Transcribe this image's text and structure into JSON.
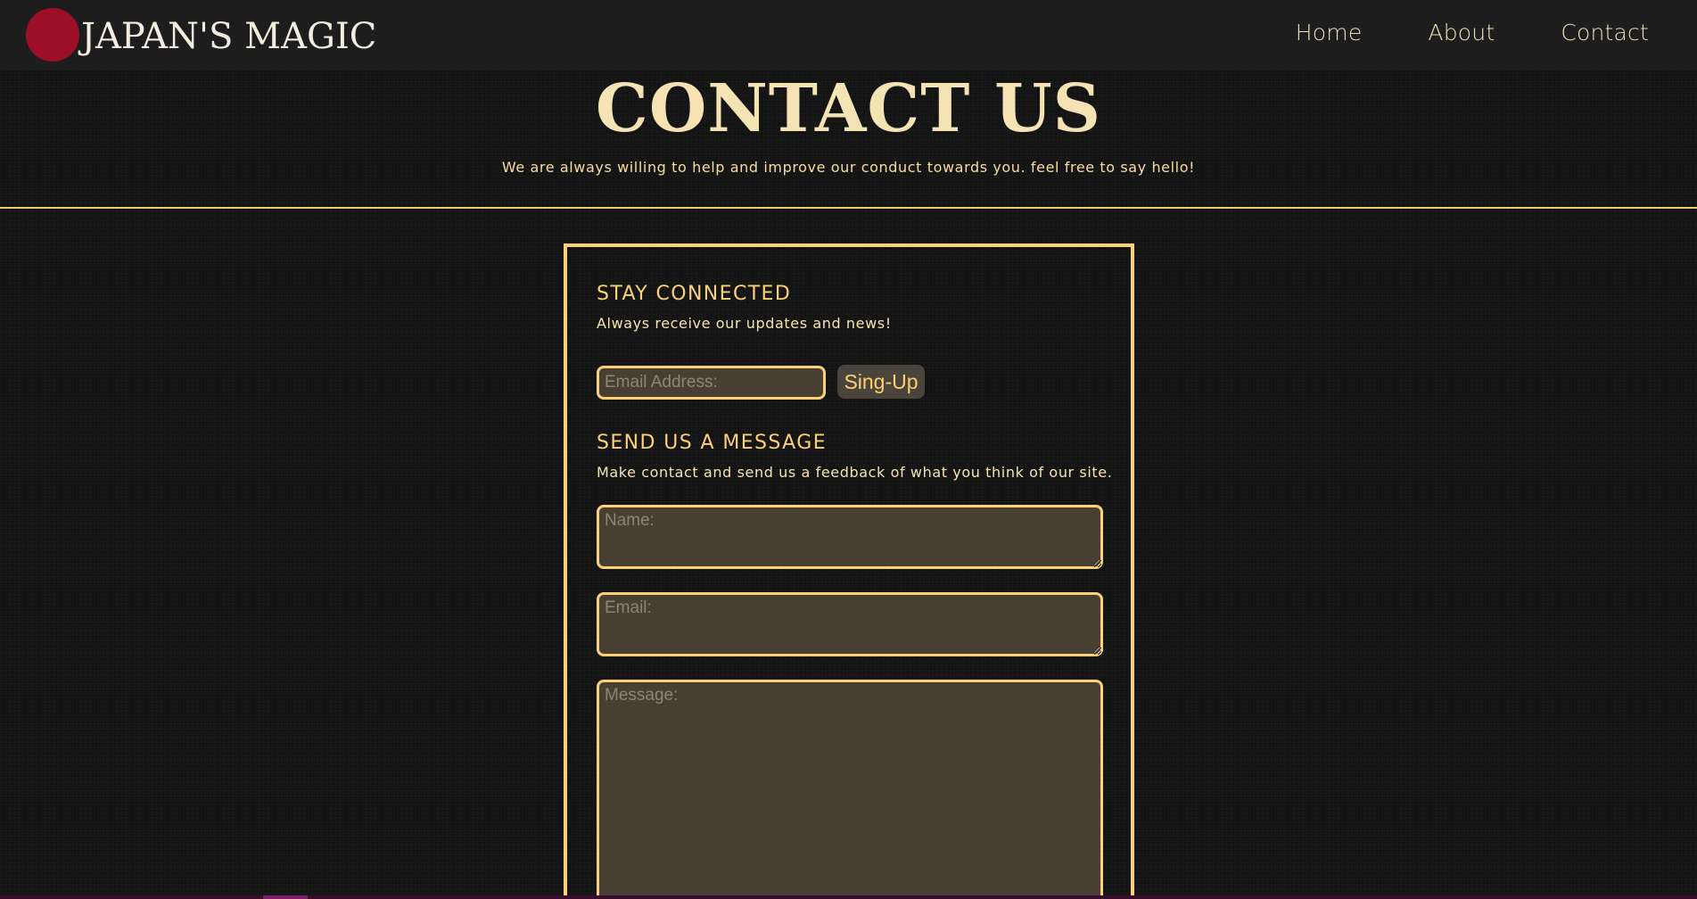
{
  "navbar": {
    "brand": "JAPAN'S MAGIC",
    "links": [
      {
        "label": "Home"
      },
      {
        "label": "About"
      },
      {
        "label": "Contact"
      }
    ]
  },
  "header": {
    "title": "CONTACT US",
    "subtitle": "We are always willing to help and improve our conduct towards you. feel free to say hello!"
  },
  "newsletter": {
    "heading": "STAY CONNECTED",
    "description": "Always receive our updates and news!",
    "email_placeholder": "Email Address:",
    "email_value": "",
    "button_label": "Sing-Up"
  },
  "message_form": {
    "heading": "SEND US A MESSAGE",
    "description": "Make contact and send us a feedback of what you think of our site.",
    "name_placeholder": "Name:",
    "email_placeholder": "Email:",
    "message_placeholder": "Message:"
  },
  "colors": {
    "accent": "#fcd076",
    "text": "#f6e3b4",
    "background": "#141414",
    "navbar": "#1c1c1c",
    "logo_sun": "#9c0f26"
  }
}
